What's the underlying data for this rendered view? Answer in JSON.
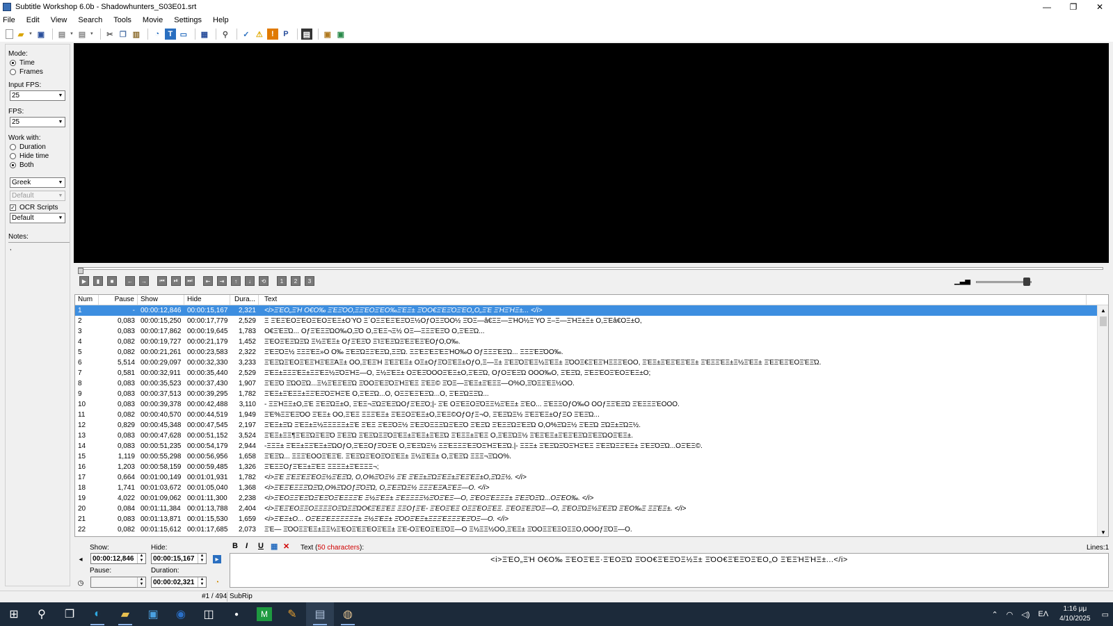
{
  "window": {
    "title": "Subtitle Workshop 6.0b - Shadowhunters_S03E01.srt",
    "minimize": "—",
    "maximize": "❐",
    "close": "✕"
  },
  "menu": [
    "File",
    "Edit",
    "View",
    "Search",
    "Tools",
    "Movie",
    "Settings",
    "Help"
  ],
  "toolbar_icons": [
    "new-file-icon",
    "open-icon",
    "save-icon",
    "undo-icon",
    "redo-icon",
    "cut-icon",
    "copy-icon",
    "paste-icon",
    "info-icon",
    "translate-icon",
    "subtitle-icon",
    "ocr-icon",
    "find-icon",
    "spellcheck-icon",
    "warning-icon",
    "error-icon",
    "pascal-icon",
    "film-icon",
    "export-icon",
    "import-icon"
  ],
  "left_panel": {
    "mode_label": "Mode:",
    "mode_time": "Time",
    "mode_frames": "Frames",
    "input_fps_label": "Input FPS:",
    "input_fps_value": "25",
    "fps_label": "FPS:",
    "fps_value": "25",
    "work_with_label": "Work with:",
    "work_duration": "Duration",
    "work_hide_time": "Hide time",
    "work_both": "Both",
    "language": "Greek",
    "secondary": "Default",
    "ocr_scripts_label": "OCR Scripts",
    "ocr_scripts_value": "Default",
    "notes_label": "Notes:",
    "notes_value": ","
  },
  "grid": {
    "headers": [
      "Num",
      "Pause",
      "Show",
      "Hide",
      "Dura...",
      "Text"
    ],
    "rows": [
      {
        "num": "1",
        "pause": "-",
        "show": "00:00:12,846",
        "hide": "00:00:15,167",
        "dur": "2,321",
        "text": "<i>ΞΈΟ„ΞΉ Ο€Ο‰ ΞΈΞΌΟ‚ΞΞΈΟΞΈΟ‰ΞΈΞ± ΞΌΟ€ΞΈΞΌΞΈΟ„Ο„ΞΈ ΞΉΞΉΞ±... </i>",
        "sel": true
      },
      {
        "num": "2",
        "pause": "0,083",
        "show": "00:00:15,250",
        "hide": "00:00:17,779",
        "dur": "2,529",
        "text": "Ξ ΞΈΞΈΟΞΈΟΞΈΟΞΈΞ±ΟΎΟ Ξ΄ΟΞΞΈΞΈΞΌΞ½ΟƒΟΞΞΌΟ½ ΞΌΞ―â€ΞΞ―ΞΉΟ½ΞΎΟ Ξ–Ξ―ΞΉΞ±Ξ± Ο,ΞΈâ€ΟΞ±Ο,",
        "sel": false
      },
      {
        "num": "3",
        "pause": "0,083",
        "show": "00:00:17,862",
        "hide": "00:00:19,645",
        "dur": "1,783",
        "text": "Ο€ΞΈΞΏ... ΟƒΞΈΞΞΏΟ‰Ο‚ΞΌ Ο,ΞΈΞ¬Ξ½ ΟΞ―ΞΞΞΈΞΌ Ο,ΞΈΞΏ...",
        "sel": false
      },
      {
        "num": "4",
        "pause": "0,082",
        "show": "00:00:19,727",
        "hide": "00:00:21,179",
        "dur": "1,452",
        "text": "ΞΈΟΞΈΞΏΞΏ Ξ½ΞΈΞ± ΟƒΞΈΞΌ ΞΊΞΈΞΏΞΈΞΈΞΈΟƒΟ‚Ο‰.",
        "sel": false
      },
      {
        "num": "5",
        "pause": "0,082",
        "show": "00:00:21,261",
        "hide": "00:00:23,583",
        "dur": "2,322",
        "text": "ΞΈΞΌΞ½ ΞΞΞΈΞ»Ο Ο‰ ΞΈΞΏΞΞΈΞΏ,ΞΞΏ. ΞΞΈΞΈΞΈΞΉΟ‰Ο ΟƒΞΞΞΈΞΏ... ΞΞΞΈΞΌΟ‰.",
        "sel": false
      },
      {
        "num": "6",
        "pause": "5,514",
        "show": "00:00:29,097",
        "hide": "00:00:32,330",
        "dur": "3,233",
        "text": "ΞΈΞΏΞΈΟΞΈΞΉΞΈΞΆΞ± ΟΟ,ΞΈΞΉ ΞΈΞΈΞ± ΟΞ±ΟƒΞΌΞΈΞ±ΟƒΟ,Ξ―Ξ± ΞΈΞΌΞΈΞ½ΞΈΞ± ΞΌΟΞ€ΞΈΞΉΞΞΞΈΟΟ, ΞΈΞ±ΞΈΞΈΞΈΞ± ΞΈΞΞΈΞ±Ξ½ΞΈΞ± ΞΈΞΈΞΈΟΞΈΞΏ.",
        "sel": false
      },
      {
        "num": "7",
        "pause": "0,581",
        "show": "00:00:32,911",
        "hide": "00:00:35,440",
        "dur": "2,529",
        "text": "ΞΈΞ±ΞΞΞΈΞ±ΞΞΈΞ½ΞΌΞΉΞ―Ο, Ξ½ΞΈΞ± ΟΞΈΞΌΟΟΞΈΞ±Ο,ΞΈΞΏ, ΟƒΟΞΈΞΏ ΟΟΟ‰Ο, ΞΈΞΏ, ΞΈΞΈΟΞΈΟΞΈΞ±Ο;",
        "sel": false
      },
      {
        "num": "8",
        "pause": "0,083",
        "show": "00:00:35,523",
        "hide": "00:00:37,430",
        "dur": "1,907",
        "text": "ΞΈΞΌ ΞΏΟΞΏ...Ξ½ΞΈΞΈΞΏ ΞΌΟΞΈΞΌΞΉΞΈΞ ΞΈΞ© ΞΌΞ―ΞΈΞ±ΞΈΞΞ―Ο%Ο,ΞΌΞΞΈΞ½ΟΟ.",
        "sel": false
      },
      {
        "num": "9",
        "pause": "0,083",
        "show": "00:00:37,513",
        "hide": "00:00:39,295",
        "dur": "1,782",
        "text": "ΞΈΞ±ΞΈΞΞ±ΞΞΈΞΌΞΉΞΈ Ο,ΞΈΞΏ...Ο, ΟΞΞΈΞΈΞΏ...Ο, ΞΈΞΏΞΞΏ...",
        "sel": false
      },
      {
        "num": "10",
        "pause": "0,083",
        "show": "00:00:39,378",
        "hide": "00:00:42,488",
        "dur": "3,110",
        "text": "- ΞΞΉΞΞ±Ο,ΞΈ ΞΈΞΏΞ±Ο, ΞΈΞ¬ΞΏΞΈΞΏΟƒΞΈΞΌ;|- ΞΈ ΟΞΈΞΟΞΌΞΞ½ΞΈΞ± ΞΈΟ... ΞΈΞΞΟƒΟ‰Ο ΟΟƒΞΞΈΞΏ ΞΈΞΞΞΈΟΟΟ.",
        "sel": false
      },
      {
        "num": "11",
        "pause": "0,082",
        "show": "00:00:40,570",
        "hide": "00:00:44,519",
        "dur": "1,949",
        "text": "ΞΈ%ΞΞΈΞΌΟ ΞΈΞ± ΟΟ,ΞΈΞ ΞΞΞΈΞ± ΞΈΞΟΞΈΞ±Ο,ΞΈΞ©ΟƒΟƒΞ¬Ο, ΞΈΞΏΞ½ ΞΈΞΈΞ±ΟƒΞΟ ΞΈΞΏ...",
        "sel": false
      },
      {
        "num": "12",
        "pause": "0,829",
        "show": "00:00:45,348",
        "hide": "00:00:47,545",
        "dur": "2,197",
        "text": "ΞΈΞ±ΞΏ ΞΈΞ±Ξ½ΞΞΞΞΞ±ΞΈ ΞΈΞ ΞΈΞΌΞ½ ΞΈΞΌΞΞΞΏΞΈΞΌ ΞΈΞΏ ΞΈΞΞΏΞΈΞΏ Ο,Ο%ΞΏΞ½ ΞΈΞΏ ΞΏΞ±ΞΏΞ½.",
        "sel": false
      },
      {
        "num": "13",
        "pause": "0,083",
        "show": "00:00:47,628",
        "hide": "00:00:51,152",
        "dur": "3,524",
        "text": "ΞΈΞ±ΞΞ¶ΞΈΞΏΞΈΞΌ ΞΈΞΏ ΞΈΞΏΞΞΌΞΈΞ±ΞΈΞ±ΞΈΞΏ ΞΈΞΞ±ΞΈΞ Ο,ΞΈΞΏΞ½ ΞΈΞΈΞ±ΞΈΞΈΞΏΞΈΞΏΟΞΈΞ±.",
        "sel": false
      },
      {
        "num": "14",
        "pause": "0,083",
        "show": "00:00:51,235",
        "hide": "00:00:54,179",
        "dur": "2,944",
        "text": "-ΞΞΞ± ΞΈΞ±ΞΞΈΞ±ΞΏΟƒΟ,ΞΈΞΟƒΞΌΞΈ Ο,ΞΈΞΏΞ½ ΞΞΈΞΞΞΈΞΌΞΉΞΈΞΏ.|- ΞΞΞ± ΞΈΞΏΞΌΞΉΞΈΞ ΞΈΞΏΞΞΈΞ± ΞΈΞΌΞΏ...ΟΞΈΞ©.",
        "sel": false
      },
      {
        "num": "15",
        "pause": "1,119",
        "show": "00:00:55,298",
        "hide": "00:00:56,956",
        "dur": "1,658",
        "text": "ΞΈΞΏ... ΞΞΞΈΟΟΞΈΞΈ. ΞΈΞΏΞΈΟΞΌΞΈΞ± Ξ½ΞΈΞ± Ο,ΞΈΞΏ ΞΞΞ¬ΞΏΟ%.",
        "sel": false
      },
      {
        "num": "16",
        "pause": "1,203",
        "show": "00:00:58,159",
        "hide": "00:00:59,485",
        "dur": "1,326",
        "text": "ΞΈΞΞΟƒΞΈΞ±ΞΈΞ ΞΞΞΞ±ΞΈΞΞΞ¬;",
        "sel": false
      },
      {
        "num": "17",
        "pause": "0,664",
        "show": "00:01:00,149",
        "hide": "00:01:01,931",
        "dur": "1,782",
        "text": "<i>ΞΈ ΞΈΞΈΞΈΟΞ½ΞΈΞΏ, Ο,Ο%ΞΌΞ½ ΞΈ ΞΈΞ±ΞΏΞΈΞ±ΞΈΞΈΞ±Ο,ΞΏΞ½. </i>",
        "sel": false
      },
      {
        "num": "18",
        "pause": "1,741",
        "show": "00:01:03,672",
        "hide": "00:01:05,040",
        "dur": "1,368",
        "text": "<i>ΞΈΞΈΞΞΞΏΞΏ,Ο%ΞΏΟƒΞΌΞΏ, Ο,ΞΈΞΏΞ½ ΞΞΞΈΞΆΞΈΞ—Ο. </i>",
        "sel": false
      },
      {
        "num": "19",
        "pause": "4,022",
        "show": "00:01:09,062",
        "hide": "00:01:11,300",
        "dur": "2,238",
        "text": "<i>ΞΈΟΞΞΈΞΏΞΈΞΌΞΈΞΞΞΈ Ξ½ΞΈΞ± ΞΈΞΞΞΞ½ΞΌΞΈΞ―Ο, ΞΈΟΞΈΞΞΞ± ΞΈΞΌΞΏ...ΟΞΈΟ‰. </i>",
        "sel": false
      },
      {
        "num": "20",
        "pause": "0,084",
        "show": "00:01:11,384",
        "hide": "00:01:13,788",
        "dur": "2,404",
        "text": "<i>ΞΈΞΈΟΞΞΟΞΞΞΞΟΞΏΞΞΏΟ€ΞΈΞΈΞ ΞΞΟƒΞΈ- ΞΈΟΞΈΞ ΟΞΞΈΟΞΈΞ. ΞΈΟΞΈΞΌΞ—Ο, ΞΈΟΞΏΞ½ΞΈΞΏ ΞΈΟ‰Ξ ΞΞΈΞ±. </i>",
        "sel": false
      },
      {
        "num": "21",
        "pause": "0,083",
        "show": "00:01:13,871",
        "hide": "00:01:15,530",
        "dur": "1,659",
        "text": "<i>ΞΈΞ±Ο... ΟΞΈΞΈΞΞΞΞΞΞ± Ξ½ΞΈΞ± ΞΌΟΞΈΞ±ΞΞΞΈΞΞΞΈΞΌΞ—Ο. </i>",
        "sel": false
      },
      {
        "num": "22",
        "pause": "0,082",
        "show": "00:01:15,612",
        "hide": "00:01:17,685",
        "dur": "2,073",
        "text": "ΞΈ— ΞΌΟΞΞΈΞ±ΞΞ½ΞΈΟΞΈΞΈΟΞΈΞ± ΞΈ-ΟΞΈΟΞΈΞΌΞ—Ο Ξ½ΞΞ½ΟΟ,ΞΈΞ± ΞΌΟΞΞΈΞΟΞΞΟ,ΟΟΟƒΞΌΞ—Ο.",
        "sel": false
      }
    ]
  },
  "editor": {
    "show_label": "Show:",
    "show_value": "00:00:12,846",
    "hide_label": "Hide:",
    "hide_value": "00:00:15,167",
    "pause_label": "Pause:",
    "pause_value": "",
    "duration_label": "Duration:",
    "duration_value": "00:00:02,321",
    "bold": "B",
    "italic": "I",
    "underline": "U",
    "text_label_prefix": "Text (",
    "text_count": "50 characters",
    "text_label_suffix": "):",
    "lines_info": "Lines:1",
    "text_value": "<i>ΞΈΟ„ΞΉ Ο€Ο‰  ΞΈΟΞΈΞ·ΞΈΟΞΏ  ΞΌΟ€ΞΈΞΌΞ½Ξ± ΞΌΟ€ΞΈΞΌΞΈΟ„Ο  ΞΈΞΉΞΉΞ±...</i>"
  },
  "status": {
    "position": "#1 / 494",
    "format": "SubRip"
  },
  "taskbar": {
    "clock_time": "1:16 μμ",
    "clock_date": "4/10/2025",
    "lang": "ΕΛ"
  }
}
